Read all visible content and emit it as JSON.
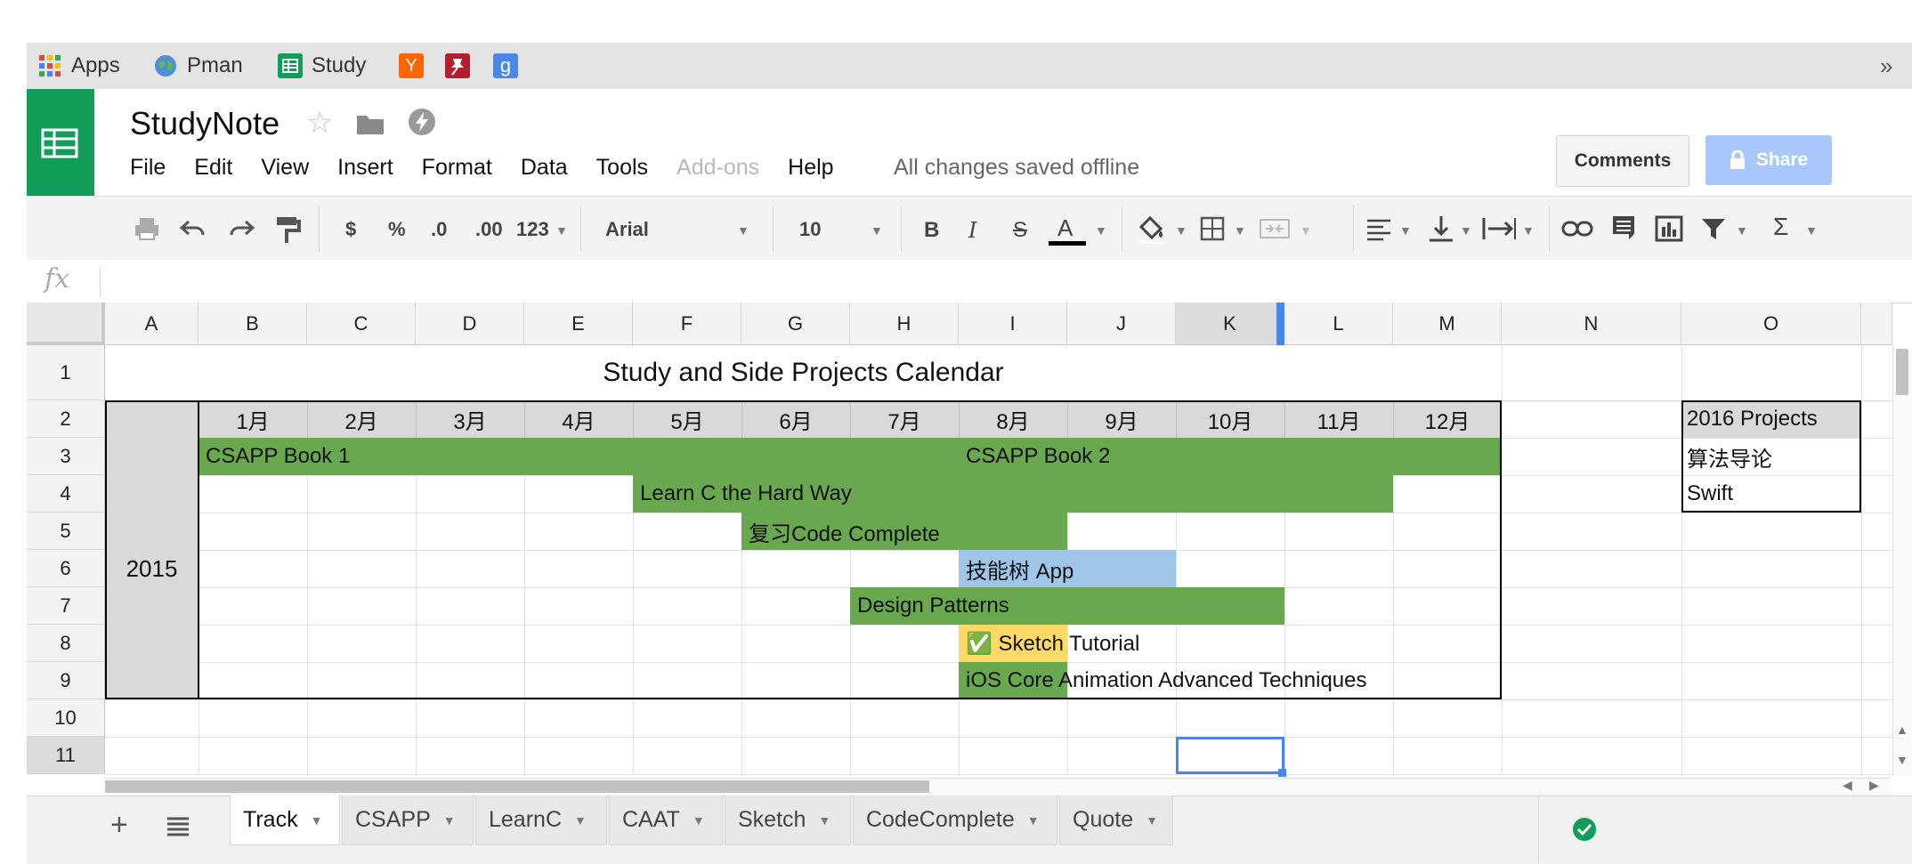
{
  "bookmarks": [
    {
      "label": "Apps",
      "icon": "apps-grid-icon"
    },
    {
      "label": "Pman",
      "icon": "globe-icon"
    },
    {
      "label": "Study",
      "icon": "sheets-icon"
    },
    {
      "label": "",
      "icon": "hacker-news-icon",
      "text": "Y"
    },
    {
      "label": "",
      "icon": "pin-icon"
    },
    {
      "label": "",
      "icon": "google-icon",
      "text": "g"
    }
  ],
  "bookmarks_overflow": "»",
  "doc": {
    "title": "StudyNote",
    "save_status": "All changes saved offline"
  },
  "menu": [
    "File",
    "Edit",
    "View",
    "Insert",
    "Format",
    "Data",
    "Tools",
    "Add-ons",
    "Help"
  ],
  "buttons": {
    "comments": "Comments",
    "share": "Share"
  },
  "toolbar": {
    "currency": "$",
    "percent": "%",
    "dec_decrease": ".0",
    "dec_increase": ".00",
    "number_format": "123",
    "font": "Arial",
    "font_size": "10",
    "bold": "B",
    "italic": "I",
    "strike": "S",
    "text_color": "A",
    "sum": "Σ"
  },
  "formula_bar": {
    "fx": "fx",
    "value": ""
  },
  "columns": [
    "A",
    "B",
    "C",
    "D",
    "E",
    "F",
    "G",
    "H",
    "I",
    "J",
    "K",
    "L",
    "M",
    "N",
    "O"
  ],
  "rows": [
    "1",
    "2",
    "3",
    "4",
    "5",
    "6",
    "7",
    "8",
    "9",
    "10",
    "11"
  ],
  "sheet": {
    "title": "Study and Side Projects Calendar",
    "months": [
      "1月",
      "2月",
      "3月",
      "4月",
      "5月",
      "6月",
      "7月",
      "8月",
      "9月",
      "10月",
      "11月",
      "12月"
    ],
    "year": "2015",
    "tasks": [
      {
        "label": "CSAPP Book 1",
        "color": "#6aa84f"
      },
      {
        "label": "CSAPP Book 2",
        "color": "#6aa84f"
      },
      {
        "label": "Learn C the Hard Way",
        "color": "#6aa84f"
      },
      {
        "label": "复习Code Complete",
        "color": "#6aa84f"
      },
      {
        "label": "技能树 App",
        "color": "#9fc5e8"
      },
      {
        "label": "Design Patterns",
        "color": "#6aa84f"
      },
      {
        "label": "✅ Sketch Tutorial",
        "color": "#ffd966"
      },
      {
        "label": "iOS Core Animation Advanced Techniques",
        "color": "#6aa84f"
      }
    ],
    "projects_2016": {
      "header": "2016 Projects",
      "items": [
        "算法导论",
        "Swift"
      ]
    }
  },
  "tabs": [
    {
      "label": "Track",
      "active": true
    },
    {
      "label": "CSAPP",
      "active": false
    },
    {
      "label": "LearnC",
      "active": false
    },
    {
      "label": "CAAT",
      "active": false
    },
    {
      "label": "Sketch",
      "active": false
    },
    {
      "label": "CodeComplete",
      "active": false
    },
    {
      "label": "Quote",
      "active": false
    }
  ],
  "colors": {
    "brand_green": "#0f9d58",
    "bar_green": "#6aa84f",
    "bar_blue": "#9fc5e8",
    "bar_yellow": "#ffd966",
    "share_blue": "#a8c7fa"
  }
}
